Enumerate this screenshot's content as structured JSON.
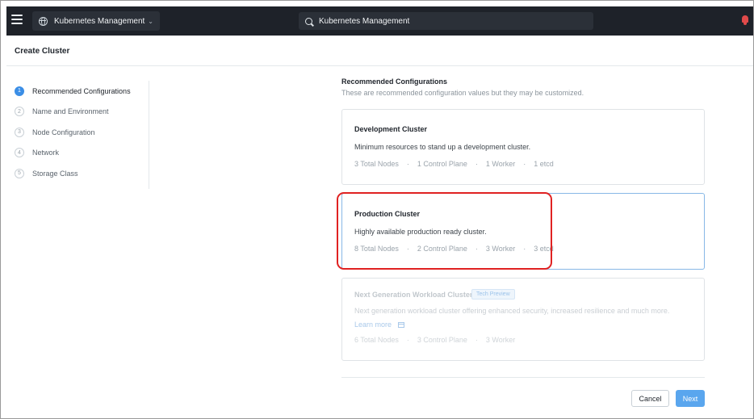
{
  "topbar": {
    "app_switcher_label": "Kubernetes Management",
    "search_value": "Kubernetes Management",
    "icons": [
      "menu-icon",
      "globe-icon",
      "chevron-down-icon",
      "search-icon",
      "bell-icon"
    ],
    "alert_color": "#e04a4a"
  },
  "page": {
    "title": "Create Cluster"
  },
  "steps": [
    {
      "number": "1",
      "label": "Recommended Configurations",
      "active": true
    },
    {
      "number": "2",
      "label": "Name and Environment"
    },
    {
      "number": "3",
      "label": "Node Configuration"
    },
    {
      "number": "4",
      "label": "Network"
    },
    {
      "number": "5",
      "label": "Storage Class"
    }
  ],
  "main": {
    "title": "Recommended Configurations",
    "subtitle": "These are recommended configuration values but they may be customized.",
    "cards": [
      {
        "title": "Development Cluster",
        "description": "Minimum resources to stand up a development cluster.",
        "stats": [
          "3 Total Nodes",
          "1 Control Plane",
          "1 Worker",
          "1 etcd"
        ]
      },
      {
        "title": "Production Cluster",
        "description": "Highly available production ready cluster.",
        "stats": [
          "8 Total Nodes",
          "2 Control Plane",
          "3 Worker",
          "3 etcd"
        ],
        "selected": true
      },
      {
        "title": "Next Generation Workload Cluster",
        "badge": "Tech Preview",
        "description": "Next generation workload cluster offering enhanced security, increased resilience and much more.",
        "link": "Learn more",
        "stats": [
          "6 Total Nodes",
          "3 Control Plane",
          "3 Worker"
        ],
        "disabled": true
      }
    ],
    "stat_separator": "·"
  },
  "footer": {
    "cancel_label": "Cancel",
    "next_label": "Next"
  },
  "colors": {
    "accent": "#3b8ee6",
    "primary_button": "#5aa6ee",
    "highlight": "#e02222"
  }
}
